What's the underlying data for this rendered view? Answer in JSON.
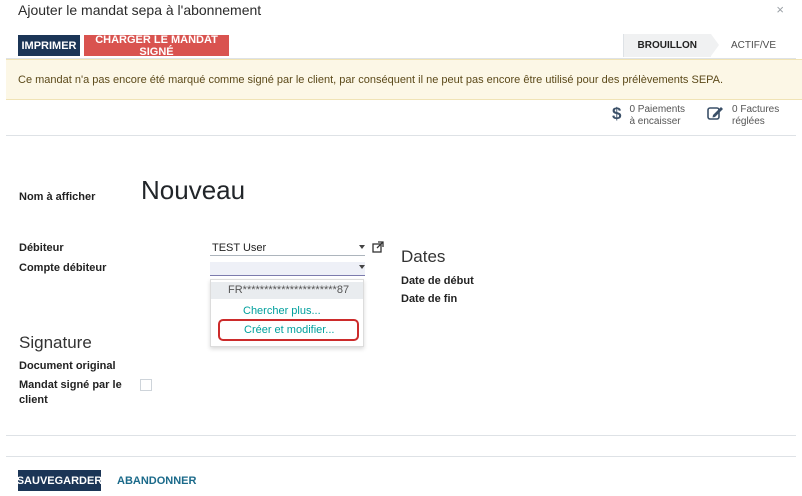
{
  "modal": {
    "title": "Ajouter le mandat sepa à l'abonnement",
    "close": "×"
  },
  "toolbar": {
    "print_label": "IMPRIMER",
    "charge_label": "CHARGER LE MANDAT SIGNÉ"
  },
  "statusbar": {
    "stages": [
      "BROUILLON",
      "ACTIF/VE"
    ],
    "active_stage": "BROUILLON"
  },
  "alert": {
    "message": "Ce mandat n'a pas encore été marqué comme signé par le client, par conséquent il ne peut pas encore être utilisé pour des prélèvements SEPA."
  },
  "smart_buttons": {
    "payments": {
      "icon": "dollar-icon",
      "line1": "0 Paiements",
      "line2": "à encaisser"
    },
    "invoices": {
      "icon": "edit-invoice-icon",
      "line1": "0 Factures",
      "line2": "réglées"
    }
  },
  "form": {
    "display_name_label": "Nom à afficher",
    "display_name_value": "Nouveau",
    "debtor_label": "Débiteur",
    "debtor_value": "TEST User",
    "debtor_account_label": "Compte débiteur",
    "debtor_account_value": "",
    "dates_title": "Dates",
    "start_date_label": "Date de début",
    "end_date_label": "Date de fin",
    "signature_title": "Signature",
    "original_doc_label": "Document original",
    "signed_label_line1": "Mandat signé par le",
    "signed_label_line2": "client",
    "signed_value": false
  },
  "dropdown": {
    "iban": "FR**********************87",
    "search_more": "Chercher plus...",
    "create_edit": "Créer et modifier..."
  },
  "footer": {
    "save_label": "SAUVEGARDER",
    "cancel_label": "ABANDONNER"
  },
  "colors": {
    "primary": "#1b3556",
    "danger": "#d9534f",
    "link": "#00a09d",
    "highlight": "#cc2b2b",
    "alert_bg": "#fcf7e6"
  }
}
